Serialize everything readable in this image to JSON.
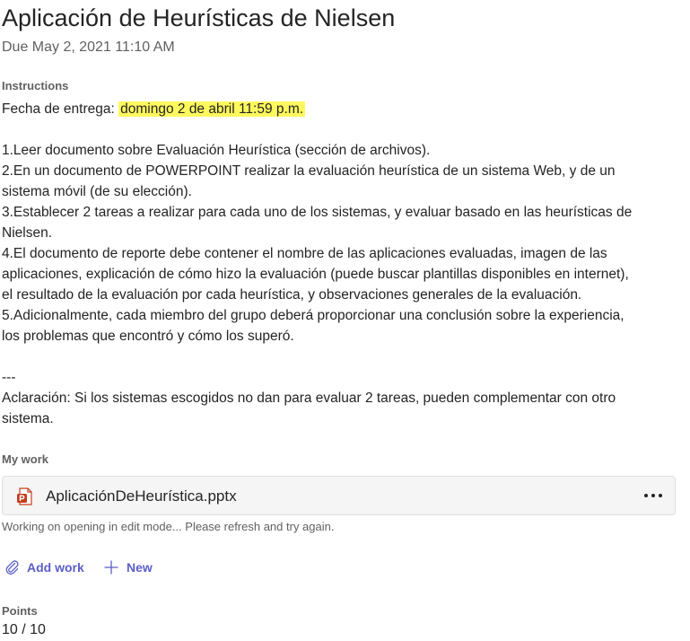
{
  "assignment": {
    "title": "Aplicación de Heurísticas de Nielsen",
    "due": "Due May 2, 2021 11:10 AM"
  },
  "instructions": {
    "label": "Instructions",
    "due_prefix": "Fecha de entrega: ",
    "due_highlight": "domingo 2 de abril 11:59 p.m.",
    "lines": [
      "1.Leer documento sobre Evaluación Heurística (sección de archivos).",
      "2.En un documento de POWERPOINT realizar la evaluación heurística de un sistema Web, y de un",
      "sistema móvil (de su elección).",
      "3.Establecer 2 tareas a realizar para cada uno de los sistemas, y evaluar basado en las heurísticas de",
      "Nielsen.",
      "4.El documento de reporte debe contener el nombre de las aplicaciones evaluadas, imagen de las",
      "aplicaciones, explicación de cómo hizo la evaluación (puede buscar plantillas disponibles en internet),",
      "el resultado de la evaluación por cada heurística, y observaciones generales de la evaluación.",
      "5.Adicionalmente, cada miembro del grupo deberá proporcionar una conclusión sobre la experiencia,",
      "los problemas que encontró y cómo los superó."
    ],
    "separator": "---",
    "note_lines": [
      "Aclaración: Si los sistemas escogidos no dan para evaluar 2 tareas, pueden complementar con otro",
      "sistema."
    ]
  },
  "my_work": {
    "label": "My work",
    "file_name": "AplicaciónDeHeurística.pptx",
    "file_icon": "powerpoint-icon",
    "status_note": "Working on opening in edit mode... Please refresh and try again.",
    "add_work_label": "Add work",
    "new_label": "New",
    "accent_color": "#5b5fc7"
  },
  "points": {
    "label": "Points",
    "value": "10 / 10"
  }
}
